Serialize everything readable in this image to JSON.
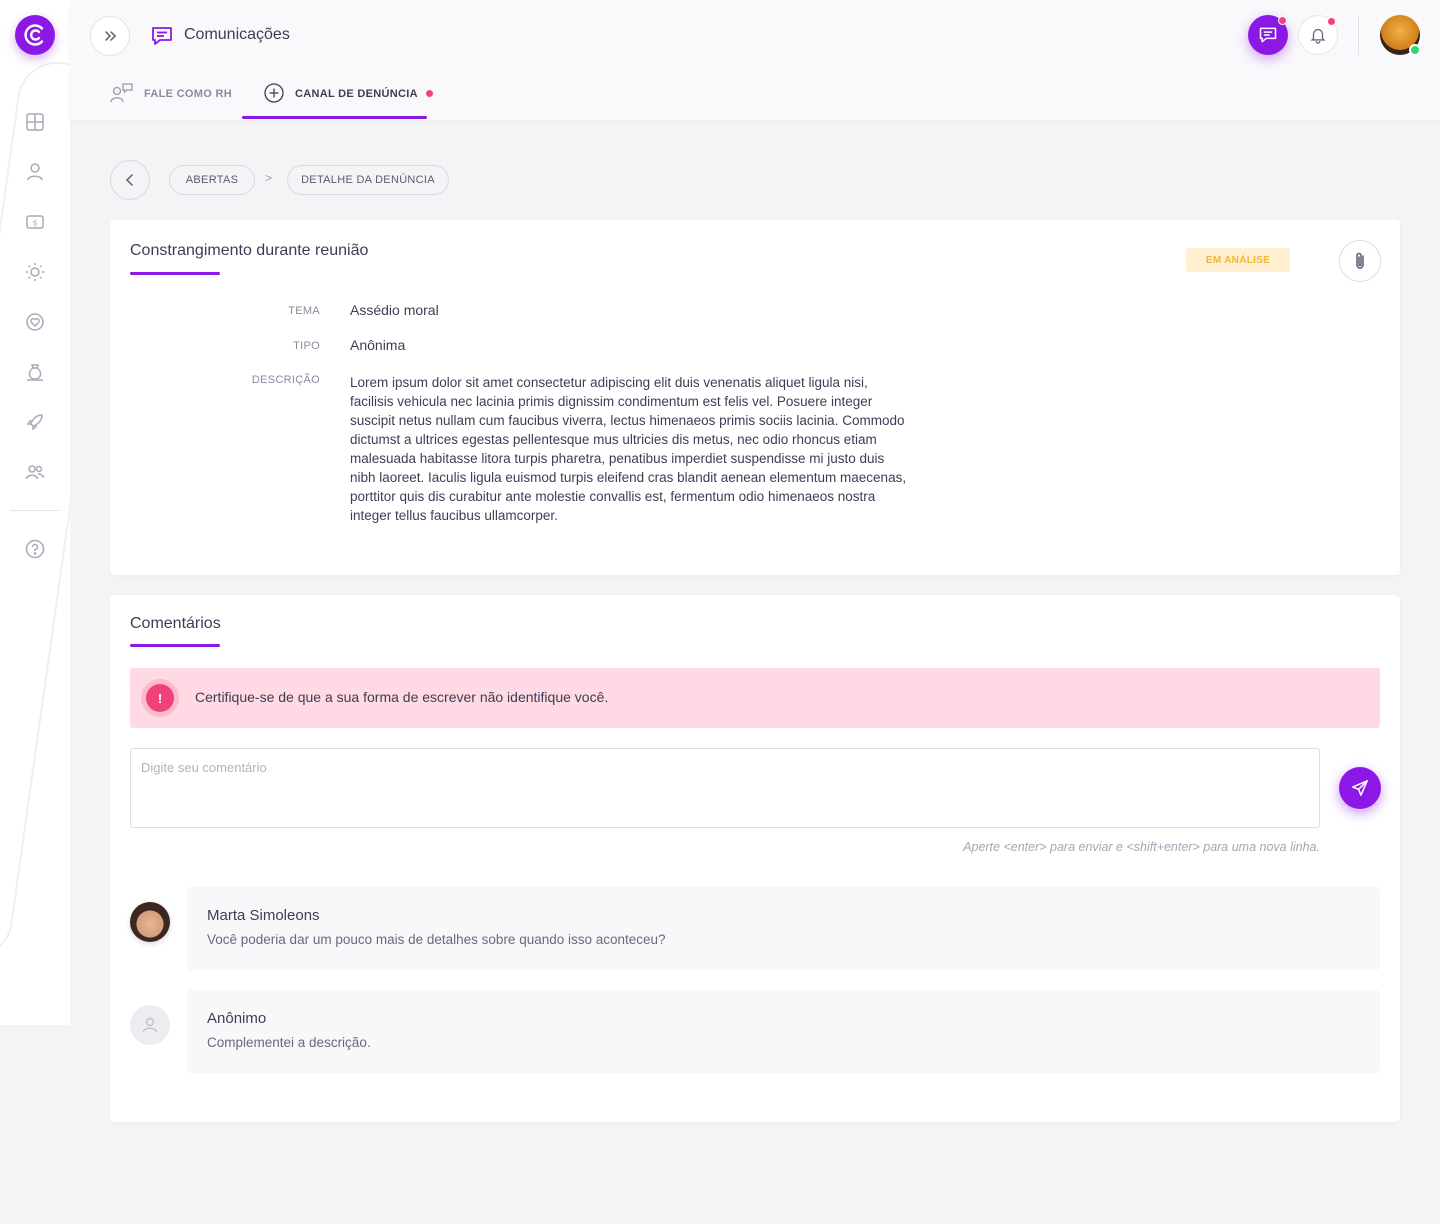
{
  "colors": {
    "accent": "#8c18e6",
    "alert": "#f0427a",
    "status_bg": "#fff0d2",
    "status_text": "#f2b734",
    "online": "#2ed47a"
  },
  "sidebar": {
    "logo_icon": "brand-logo",
    "items": [
      {
        "icon": "dashboard-icon"
      },
      {
        "icon": "user-icon"
      },
      {
        "icon": "money-icon"
      },
      {
        "icon": "sun-icon"
      },
      {
        "icon": "heart-icon"
      },
      {
        "icon": "money-bag-icon"
      },
      {
        "icon": "rocket-icon"
      },
      {
        "icon": "team-icon"
      },
      {
        "icon": "help-icon"
      }
    ]
  },
  "header": {
    "title": "Comunicações",
    "tabs": [
      {
        "label": "FALE COMO RH",
        "active": false
      },
      {
        "label": "CANAL DE DENÚNCIA",
        "active": true
      }
    ]
  },
  "breadcrumb": {
    "items": [
      "ABERTAS",
      "DETALHE DA DENÚNCIA"
    ],
    "separator": ">"
  },
  "report": {
    "title": "Constrangimento durante reunião",
    "status": "EM ANÁLISE",
    "fields": {
      "tema_label": "TEMA",
      "tema_value": "Assédio moral",
      "tipo_label": "TIPO",
      "tipo_value": "Anônima",
      "descricao_label": "DESCRIÇÃO",
      "descricao_value": "Lorem ipsum dolor sit amet consectetur adipiscing elit duis venenatis aliquet ligula nisi, facilisis vehicula nec lacinia primis dignissim condimentum est felis vel. Posuere integer suscipit netus nullam cum faucibus viverra, lectus himenaeos primis sociis lacinia. Commodo dictumst a ultrices egestas pellentesque mus ultricies dis metus, nec odio rhoncus etiam malesuada habitasse litora turpis pharetra, penatibus imperdiet suspendisse mi justo duis nibh laoreet. Iaculis ligula euismod turpis eleifend cras blandit aenean elementum maecenas, porttitor quis dis curabitur ante molestie convallis est, fermentum odio himenaeos nostra integer tellus faucibus ullamcorper."
    }
  },
  "comments": {
    "title": "Comentários",
    "alert": "Certifique-se de que a sua forma de escrever não identifique você.",
    "input_placeholder": "Digite seu comentário",
    "input_value": "",
    "hint": "Aperte <enter> para enviar e <shift+enter> para uma nova linha.",
    "items": [
      {
        "author": "Marta Simoleons",
        "text": "Você poderia dar um pouco mais de detalhes sobre quando isso aconteceu?"
      },
      {
        "author": "Anônimo",
        "text": "Complementei a descrição."
      }
    ]
  }
}
